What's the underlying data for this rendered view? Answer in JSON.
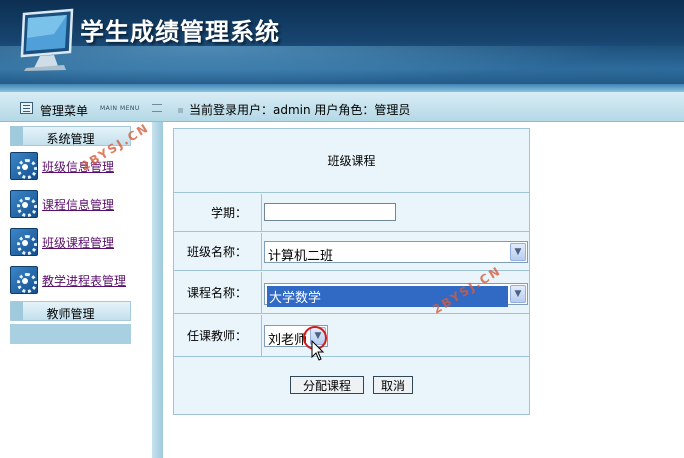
{
  "app": {
    "title": "学生成绩管理系统"
  },
  "header": {
    "menu_title": "管理菜单",
    "menu_subtitle": "MAIN MENU",
    "login_info": "当前登录用户：admin 用户角色：管理员"
  },
  "sidebar": {
    "groups": [
      {
        "label": "系统管理",
        "items": [
          {
            "label": "班级信息管理"
          },
          {
            "label": "课程信息管理"
          },
          {
            "label": "班级课程管理"
          },
          {
            "label": "教学进程表管理"
          }
        ]
      },
      {
        "label": "教师管理",
        "items": []
      }
    ]
  },
  "form": {
    "caption": "班级课程",
    "semester_label": "学期：",
    "semester_value": "",
    "class_label": "班级名称：",
    "class_value": "计算机二班",
    "course_label": "课程名称：",
    "course_value": "大学数学",
    "teacher_label": "任课教师：",
    "teacher_value": "刘老师",
    "submit_label": "分配课程",
    "cancel_label": "取消"
  },
  "watermark": {
    "text": "2BYSJ.CN"
  },
  "colors": {
    "banner": "#17456f",
    "highlight": "#316ac5",
    "link": "#5a0f6b",
    "panel": "#e9f5fa"
  }
}
